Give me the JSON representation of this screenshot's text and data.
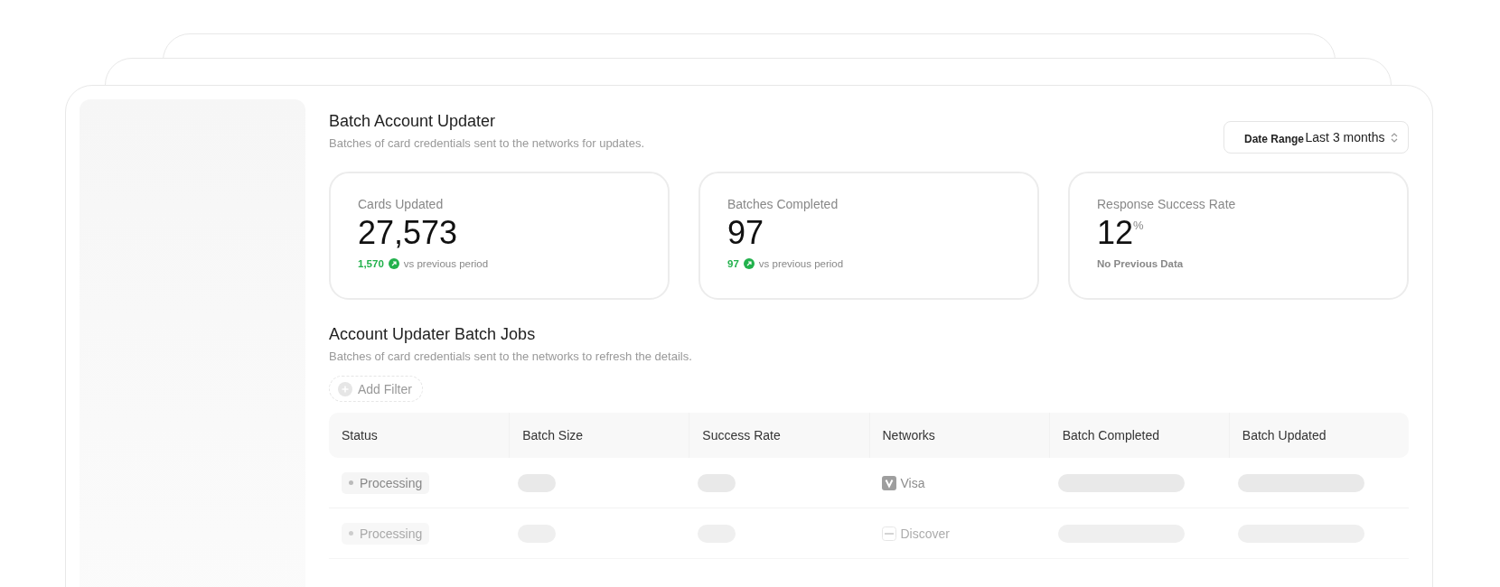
{
  "header": {
    "title": "Batch Account Updater",
    "subtitle": "Batches of card credentials sent to the networks for updates."
  },
  "date_range": {
    "label": "Date Range",
    "value": "Last 3 months"
  },
  "stats": [
    {
      "label": "Cards Updated",
      "value": "27,573",
      "change": "1,570",
      "note": "vs previous period"
    },
    {
      "label": "Batches Completed",
      "value": "97",
      "change": "97",
      "note": "vs previous period"
    },
    {
      "label": "Response Success Rate",
      "value": "12",
      "unit": "%",
      "note": "No Previous Data"
    }
  ],
  "jobs": {
    "title": "Account Updater Batch Jobs",
    "subtitle": "Batches of card credentials sent to the networks to refresh the details.",
    "add_filter": "Add Filter"
  },
  "table": {
    "columns": [
      "Status",
      "Batch Size",
      "Success Rate",
      "Networks",
      "Batch Completed",
      "Batch Updated"
    ],
    "rows": [
      {
        "status": "Processing",
        "network": "Visa",
        "kind": "visa"
      },
      {
        "status": "Processing",
        "network": "Discover",
        "kind": "discover"
      }
    ]
  }
}
